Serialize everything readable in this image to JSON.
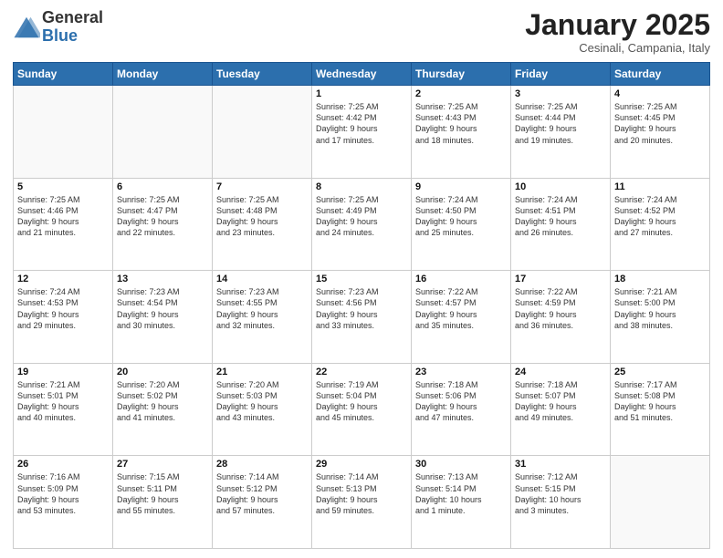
{
  "logo": {
    "general": "General",
    "blue": "Blue"
  },
  "header": {
    "month": "January 2025",
    "location": "Cesinali, Campania, Italy"
  },
  "weekdays": [
    "Sunday",
    "Monday",
    "Tuesday",
    "Wednesday",
    "Thursday",
    "Friday",
    "Saturday"
  ],
  "weeks": [
    [
      {
        "day": "",
        "detail": ""
      },
      {
        "day": "",
        "detail": ""
      },
      {
        "day": "",
        "detail": ""
      },
      {
        "day": "1",
        "detail": "Sunrise: 7:25 AM\nSunset: 4:42 PM\nDaylight: 9 hours\nand 17 minutes."
      },
      {
        "day": "2",
        "detail": "Sunrise: 7:25 AM\nSunset: 4:43 PM\nDaylight: 9 hours\nand 18 minutes."
      },
      {
        "day": "3",
        "detail": "Sunrise: 7:25 AM\nSunset: 4:44 PM\nDaylight: 9 hours\nand 19 minutes."
      },
      {
        "day": "4",
        "detail": "Sunrise: 7:25 AM\nSunset: 4:45 PM\nDaylight: 9 hours\nand 20 minutes."
      }
    ],
    [
      {
        "day": "5",
        "detail": "Sunrise: 7:25 AM\nSunset: 4:46 PM\nDaylight: 9 hours\nand 21 minutes."
      },
      {
        "day": "6",
        "detail": "Sunrise: 7:25 AM\nSunset: 4:47 PM\nDaylight: 9 hours\nand 22 minutes."
      },
      {
        "day": "7",
        "detail": "Sunrise: 7:25 AM\nSunset: 4:48 PM\nDaylight: 9 hours\nand 23 minutes."
      },
      {
        "day": "8",
        "detail": "Sunrise: 7:25 AM\nSunset: 4:49 PM\nDaylight: 9 hours\nand 24 minutes."
      },
      {
        "day": "9",
        "detail": "Sunrise: 7:24 AM\nSunset: 4:50 PM\nDaylight: 9 hours\nand 25 minutes."
      },
      {
        "day": "10",
        "detail": "Sunrise: 7:24 AM\nSunset: 4:51 PM\nDaylight: 9 hours\nand 26 minutes."
      },
      {
        "day": "11",
        "detail": "Sunrise: 7:24 AM\nSunset: 4:52 PM\nDaylight: 9 hours\nand 27 minutes."
      }
    ],
    [
      {
        "day": "12",
        "detail": "Sunrise: 7:24 AM\nSunset: 4:53 PM\nDaylight: 9 hours\nand 29 minutes."
      },
      {
        "day": "13",
        "detail": "Sunrise: 7:23 AM\nSunset: 4:54 PM\nDaylight: 9 hours\nand 30 minutes."
      },
      {
        "day": "14",
        "detail": "Sunrise: 7:23 AM\nSunset: 4:55 PM\nDaylight: 9 hours\nand 32 minutes."
      },
      {
        "day": "15",
        "detail": "Sunrise: 7:23 AM\nSunset: 4:56 PM\nDaylight: 9 hours\nand 33 minutes."
      },
      {
        "day": "16",
        "detail": "Sunrise: 7:22 AM\nSunset: 4:57 PM\nDaylight: 9 hours\nand 35 minutes."
      },
      {
        "day": "17",
        "detail": "Sunrise: 7:22 AM\nSunset: 4:59 PM\nDaylight: 9 hours\nand 36 minutes."
      },
      {
        "day": "18",
        "detail": "Sunrise: 7:21 AM\nSunset: 5:00 PM\nDaylight: 9 hours\nand 38 minutes."
      }
    ],
    [
      {
        "day": "19",
        "detail": "Sunrise: 7:21 AM\nSunset: 5:01 PM\nDaylight: 9 hours\nand 40 minutes."
      },
      {
        "day": "20",
        "detail": "Sunrise: 7:20 AM\nSunset: 5:02 PM\nDaylight: 9 hours\nand 41 minutes."
      },
      {
        "day": "21",
        "detail": "Sunrise: 7:20 AM\nSunset: 5:03 PM\nDaylight: 9 hours\nand 43 minutes."
      },
      {
        "day": "22",
        "detail": "Sunrise: 7:19 AM\nSunset: 5:04 PM\nDaylight: 9 hours\nand 45 minutes."
      },
      {
        "day": "23",
        "detail": "Sunrise: 7:18 AM\nSunset: 5:06 PM\nDaylight: 9 hours\nand 47 minutes."
      },
      {
        "day": "24",
        "detail": "Sunrise: 7:18 AM\nSunset: 5:07 PM\nDaylight: 9 hours\nand 49 minutes."
      },
      {
        "day": "25",
        "detail": "Sunrise: 7:17 AM\nSunset: 5:08 PM\nDaylight: 9 hours\nand 51 minutes."
      }
    ],
    [
      {
        "day": "26",
        "detail": "Sunrise: 7:16 AM\nSunset: 5:09 PM\nDaylight: 9 hours\nand 53 minutes."
      },
      {
        "day": "27",
        "detail": "Sunrise: 7:15 AM\nSunset: 5:11 PM\nDaylight: 9 hours\nand 55 minutes."
      },
      {
        "day": "28",
        "detail": "Sunrise: 7:14 AM\nSunset: 5:12 PM\nDaylight: 9 hours\nand 57 minutes."
      },
      {
        "day": "29",
        "detail": "Sunrise: 7:14 AM\nSunset: 5:13 PM\nDaylight: 9 hours\nand 59 minutes."
      },
      {
        "day": "30",
        "detail": "Sunrise: 7:13 AM\nSunset: 5:14 PM\nDaylight: 10 hours\nand 1 minute."
      },
      {
        "day": "31",
        "detail": "Sunrise: 7:12 AM\nSunset: 5:15 PM\nDaylight: 10 hours\nand 3 minutes."
      },
      {
        "day": "",
        "detail": ""
      }
    ]
  ]
}
